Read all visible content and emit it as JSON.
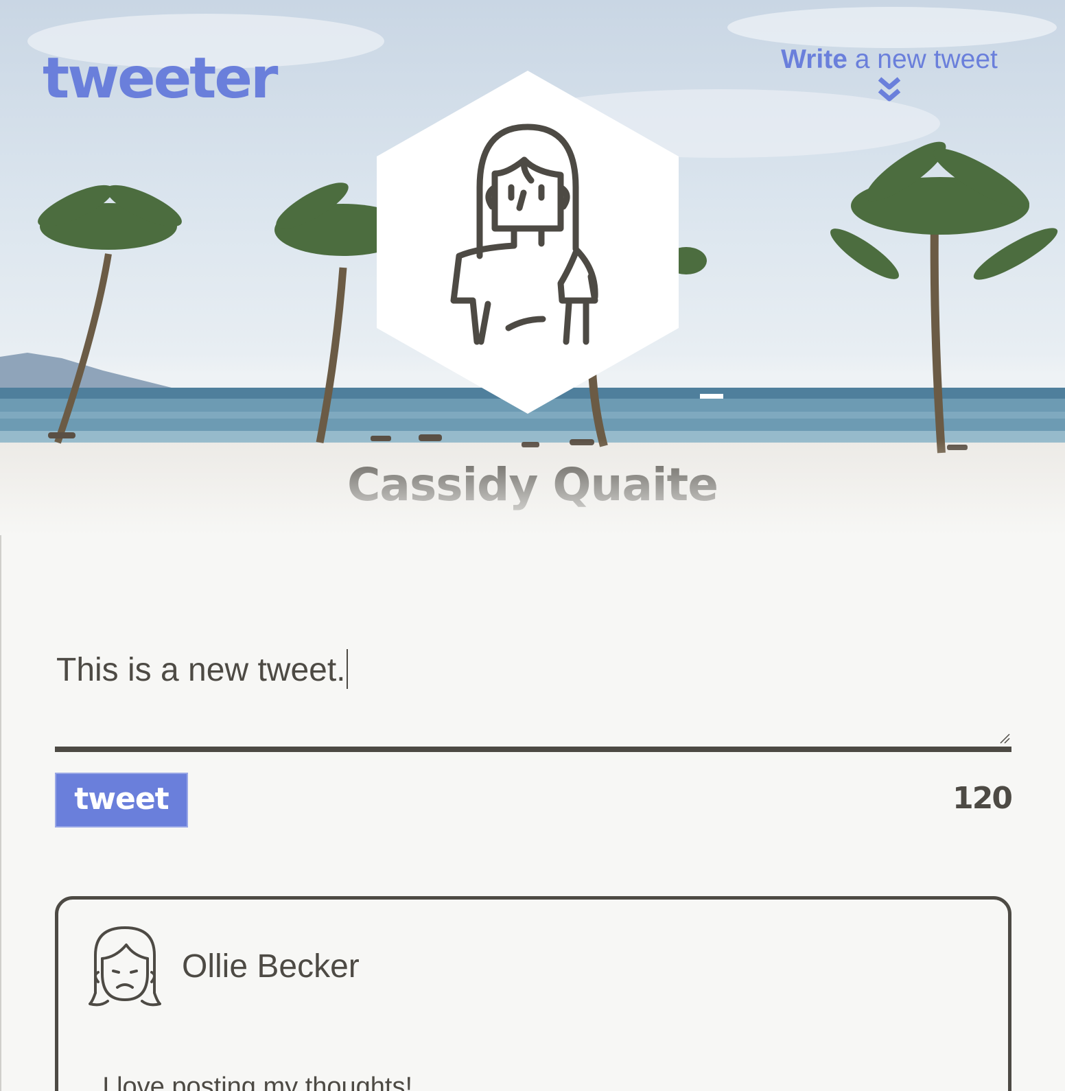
{
  "app": {
    "logo": "tweeter"
  },
  "header": {
    "write_bold": "Write",
    "write_rest": " a new tweet",
    "chevron_icon": "double-chevron-down-icon"
  },
  "profile": {
    "name": "Cassidy Quaite",
    "avatar_icon": "woman-avatar-icon"
  },
  "compose": {
    "text": "This is a new tweet.",
    "button_label": "tweet",
    "char_count": "120"
  },
  "feed": [
    {
      "author": "Ollie Becker",
      "avatar_icon": "sad-face-avatar-icon",
      "text": "I love posting my thoughts!"
    }
  ],
  "colors": {
    "accent": "#6a7fdb",
    "text": "#4d4a44",
    "background": "#f7f7f5"
  }
}
